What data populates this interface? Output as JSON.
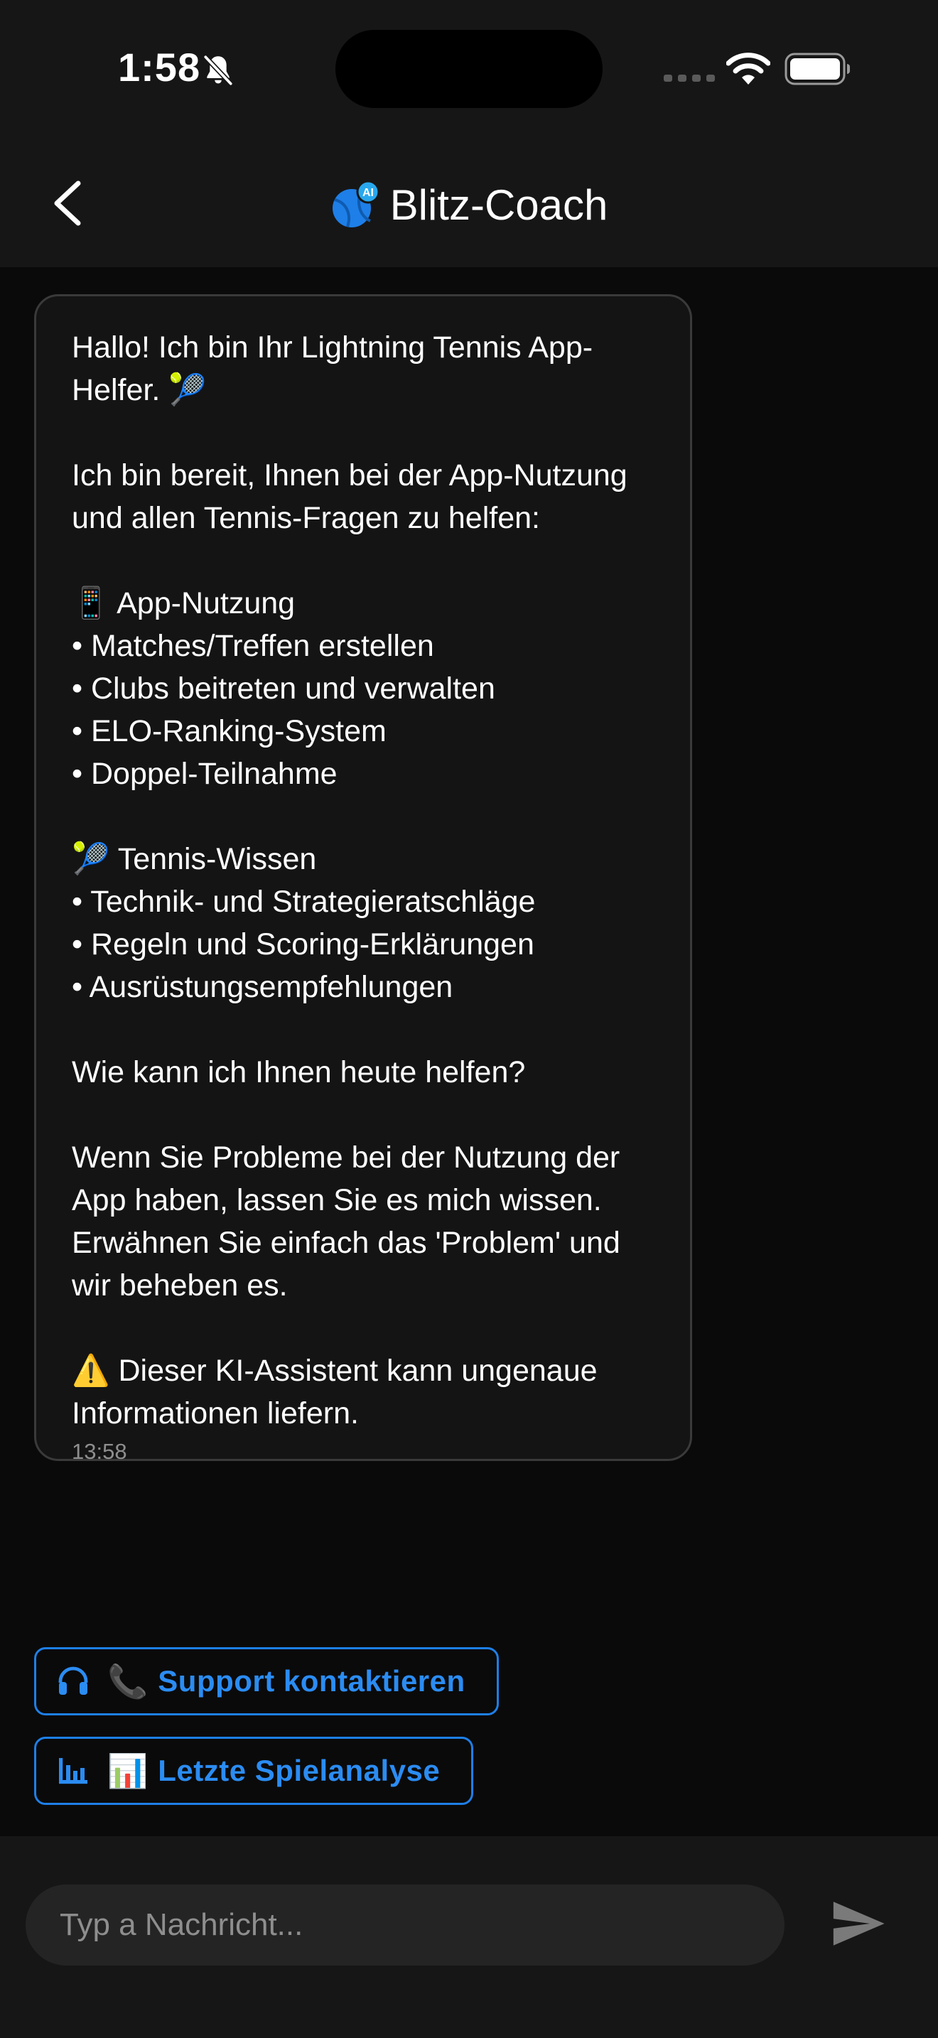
{
  "status_bar": {
    "time": "1:58",
    "icons": [
      "bell-slash-icon",
      "signal-icon",
      "wifi-icon",
      "battery-icon"
    ]
  },
  "header": {
    "title": "Blitz-Coach",
    "logo_badge": "AI",
    "back_icon": "chevron-left-icon"
  },
  "message": {
    "text": "Hallo! Ich bin Ihr Lightning Tennis App-\nHelfer. 🎾\n\nIch bin bereit, Ihnen bei der App-Nutzung\nund allen Tennis-Fragen zu helfen:\n\n📱 App-Nutzung\n• Matches/Treffen erstellen\n• Clubs beitreten und verwalten\n• ELO-Ranking-System\n• Doppel-Teilnahme\n\n🎾 Tennis-Wissen\n• Technik- und Strategieratschläge\n• Regeln und Scoring-Erklärungen\n• Ausrüstungsempfehlungen\n\nWie kann ich Ihnen heute helfen?\n\nWenn Sie Probleme bei der Nutzung der\nApp haben, lassen Sie es mich wissen.\nErwähnen Sie einfach das 'Problem' und\nwir beheben es.\n\n⚠️ Dieser KI-Assistent kann ungenaue\nInformationen liefern.",
    "time": "13:58"
  },
  "quick_actions": [
    {
      "icon": "headset-icon",
      "emoji": "📞",
      "label": "Support kontaktieren"
    },
    {
      "icon": "bar-chart-icon",
      "emoji": "📊",
      "label": "Letzte Spielanalyse"
    }
  ],
  "input": {
    "placeholder": "Typ a Nachricht...",
    "value": ""
  },
  "colors": {
    "accent": "#2b8cf2",
    "background": "#0a0a0a",
    "bar": "#161616",
    "bubble": "#141414",
    "bubble_border": "#3a3a3a"
  }
}
